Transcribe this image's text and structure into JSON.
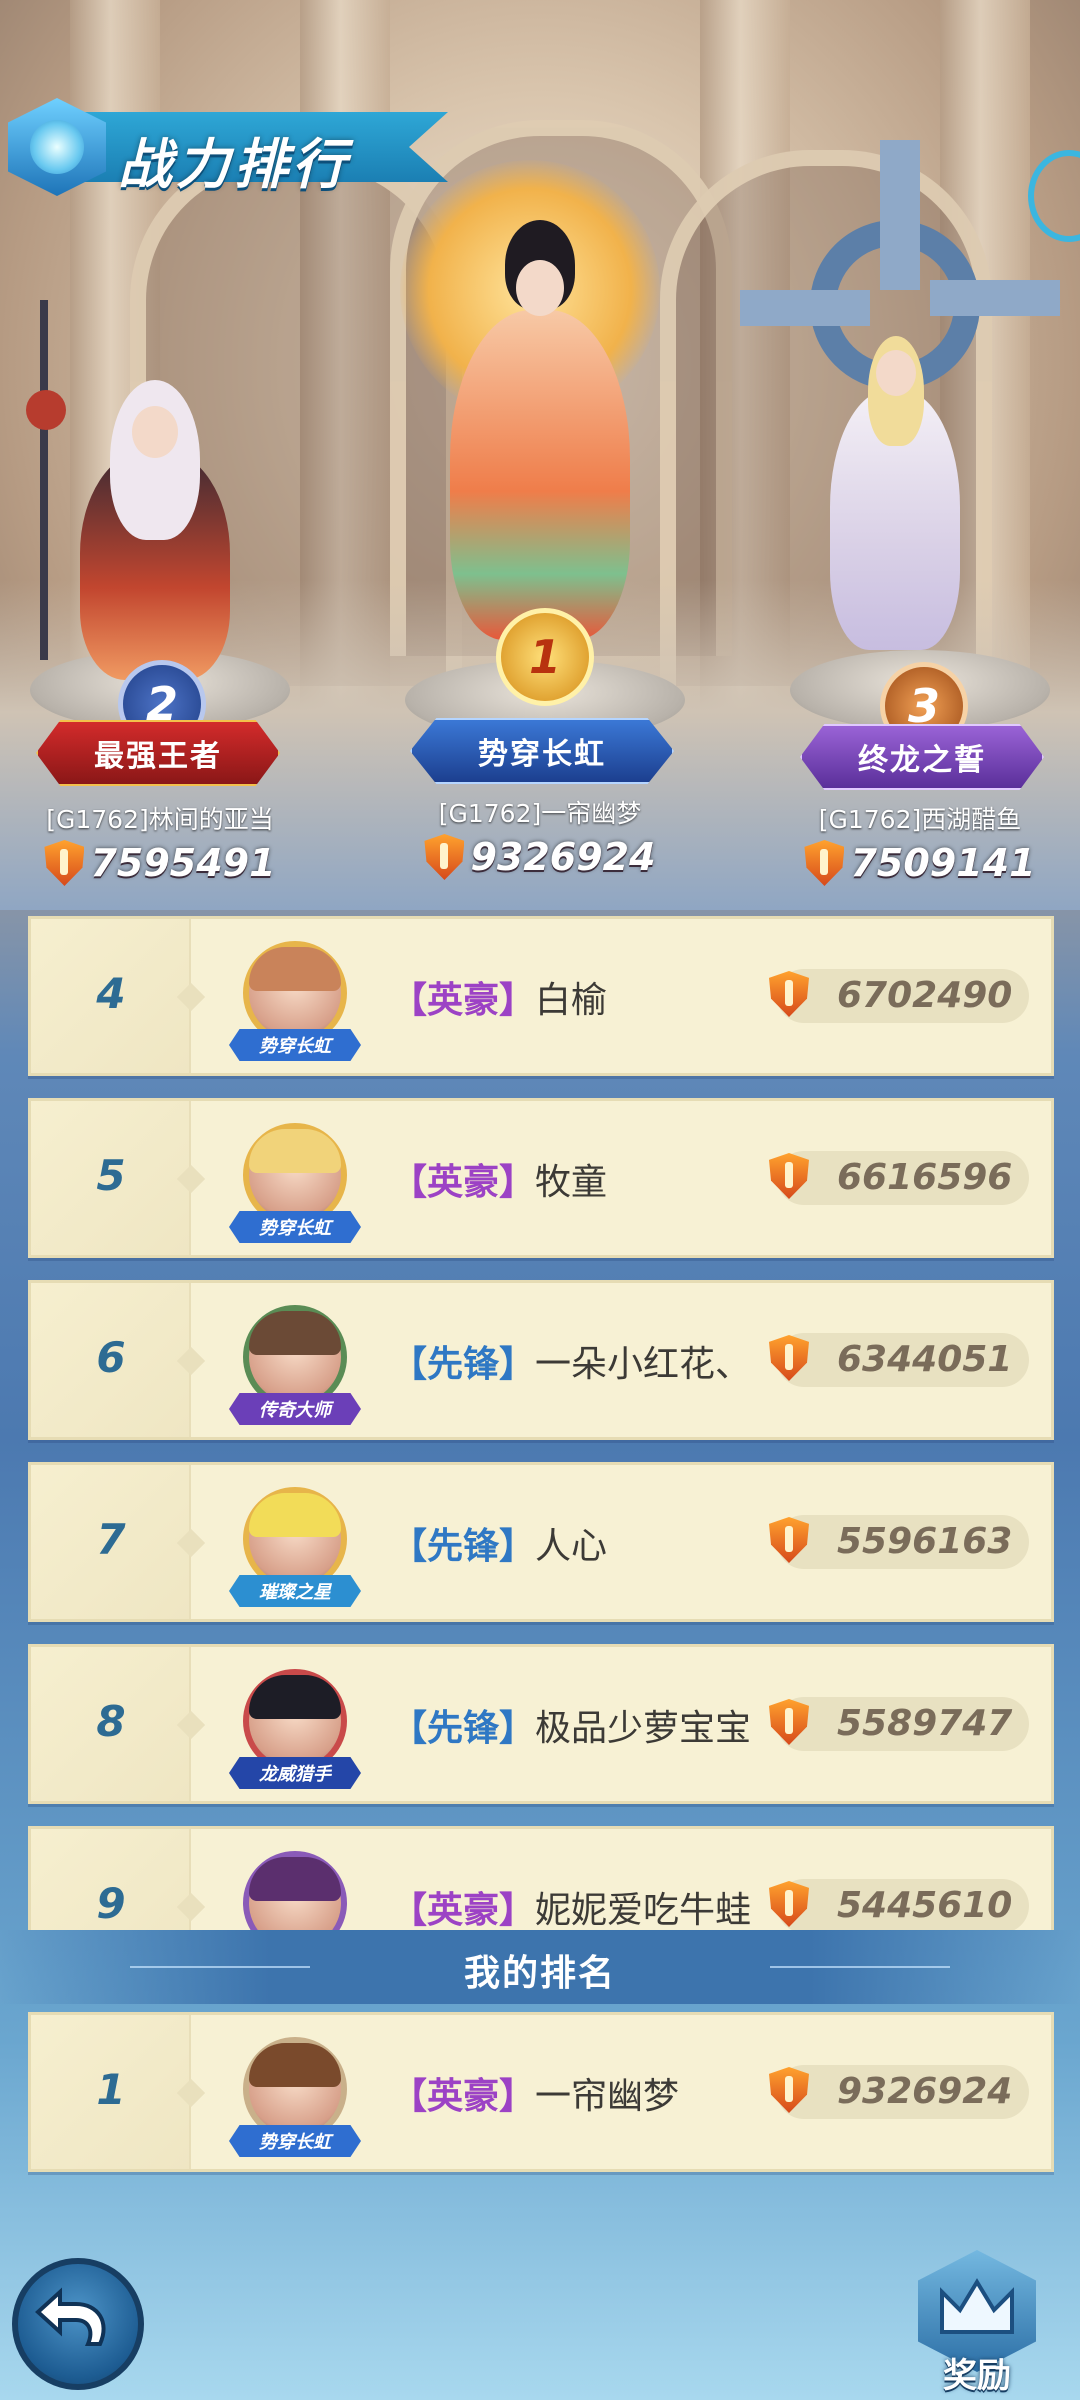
{
  "header": {
    "title": "战力排行"
  },
  "podium": [
    {
      "rank": "2",
      "title": "最强王者",
      "name": "[G1762]林间的亚当",
      "power": "7595491"
    },
    {
      "rank": "1",
      "title": "势穿长虹",
      "name": "[G1762]一帘幽梦",
      "power": "9326924"
    },
    {
      "rank": "3",
      "title": "终龙之誓",
      "name": "[G1762]西湖醋鱼",
      "power": "7509141"
    }
  ],
  "rankings": [
    {
      "rank": "4",
      "tag": "【英豪】",
      "name": "白榆",
      "badge": "势穿长虹",
      "power": "6702490"
    },
    {
      "rank": "5",
      "tag": "【英豪】",
      "name": "牧童",
      "badge": "势穿长虹",
      "power": "6616596"
    },
    {
      "rank": "6",
      "tag": "【先锋】",
      "name": "一朵小红花、",
      "badge": "传奇大师",
      "power": "6344051"
    },
    {
      "rank": "7",
      "tag": "【先锋】",
      "name": "人心",
      "badge": "璀璨之星",
      "power": "5596163"
    },
    {
      "rank": "8",
      "tag": "【先锋】",
      "name": "极品少萝宝宝",
      "badge": "龙威猎手",
      "power": "5589747"
    },
    {
      "rank": "9",
      "tag": "【英豪】",
      "name": "妮妮爱吃牛蛙",
      "badge": "",
      "power": "5445610"
    }
  ],
  "my_rank": {
    "header": "我的排名",
    "rank": "1",
    "tag": "【英豪】",
    "name": "一帘幽梦",
    "badge": "势穿长虹",
    "power": "9326924"
  },
  "buttons": {
    "reward": "奖励"
  },
  "colors": {
    "hero_tag": "#9c42c5",
    "vanguard_tag": "#2f78c4",
    "rank_number": "#2d6b93",
    "row_bg": "#f7f1d4"
  },
  "icons": {
    "power": "shield-power-icon",
    "back": "back-arrow-icon",
    "reward": "crown-reward-icon"
  }
}
